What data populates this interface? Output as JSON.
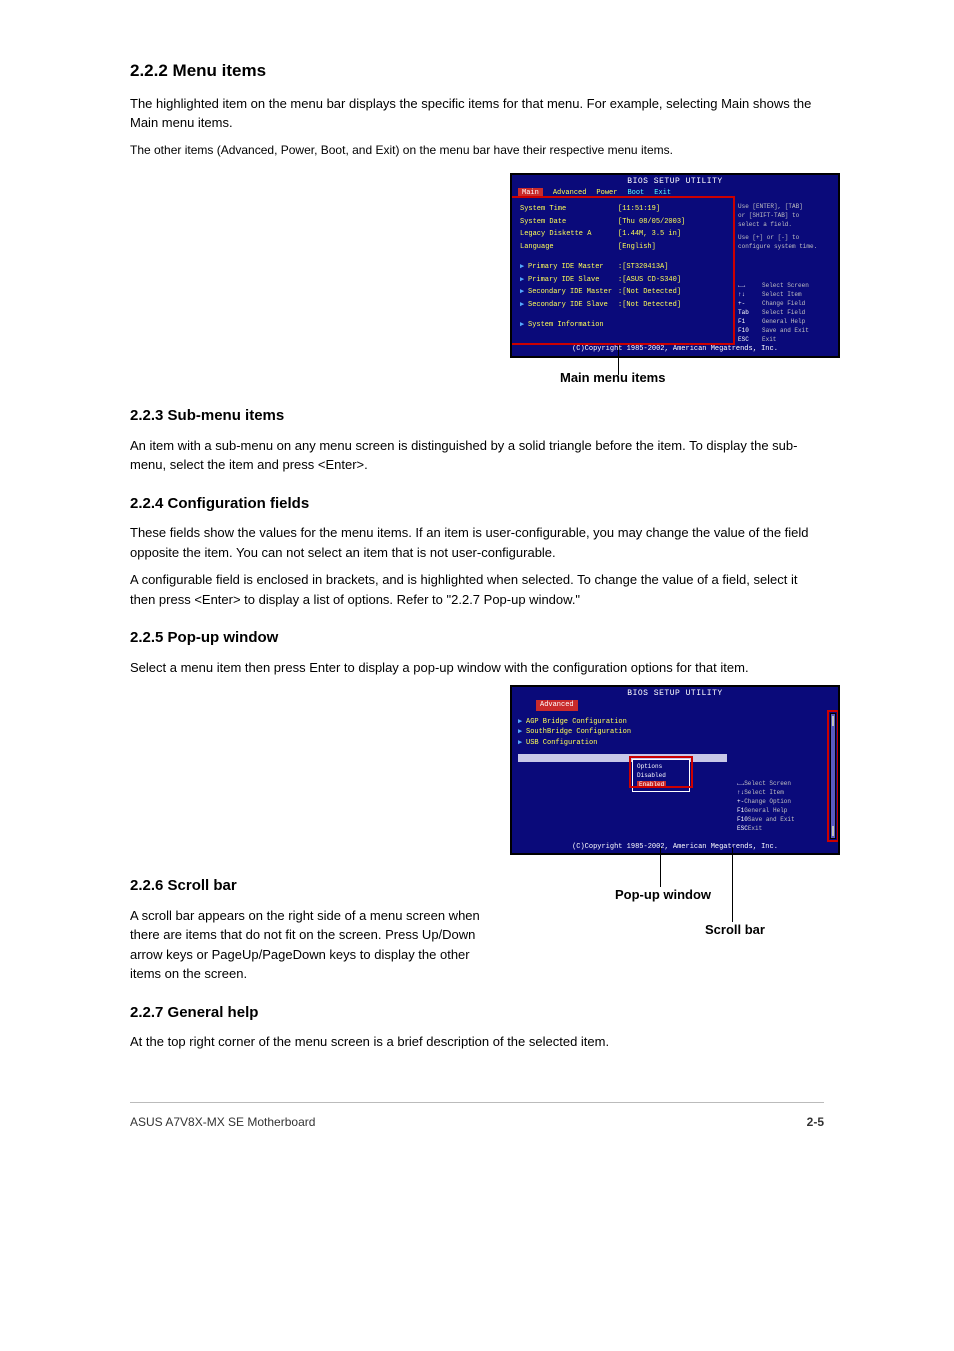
{
  "section_menu_items": {
    "title": "2.2.2 Menu items",
    "para1": "The highlighted item on the menu bar displays the specific items for that menu. For example, selecting Main shows the Main menu items.",
    "para2": "The other items (Advanced, Power, Boot, and Exit) on the menu bar have their respective menu items."
  },
  "bios1": {
    "title": "BIOS SETUP UTILITY",
    "menu": [
      "Main",
      "Advanced",
      "Power",
      "Boot",
      "Exit"
    ],
    "menu_selected": "Main",
    "rows": [
      {
        "label": "System Time",
        "value": "[11:51:19]"
      },
      {
        "label": "System Date",
        "value": "[Thu 08/05/2003]"
      },
      {
        "label": "Legacy Diskette A",
        "value": "[1.44M, 3.5 in]"
      },
      {
        "label": "Language",
        "value": "[English]"
      },
      {
        "label_blank": true
      },
      {
        "arrow": true,
        "label": "Primary IDE Master",
        "value": ":[ST320413A]"
      },
      {
        "arrow": true,
        "label": "Primary IDE Slave",
        "value": ":[ASUS CD-S340]"
      },
      {
        "arrow": true,
        "label": "Secondary IDE Master",
        "value": ":[Not Detected]"
      },
      {
        "arrow": true,
        "label": "Secondary IDE Slave",
        "value": ":[Not Detected]"
      },
      {
        "label_blank": true
      },
      {
        "arrow": true,
        "label": "System Information",
        "value": ""
      }
    ],
    "help_text": [
      "Use [ENTER], [TAB]",
      "or [SHIFT-TAB] to",
      "select a field.",
      "",
      "Use [+] or [-] to",
      "configure system time."
    ],
    "keys": [
      {
        "k": "←→",
        "d": "Select Screen"
      },
      {
        "k": "↑↓",
        "d": "Select Item"
      },
      {
        "k": "+-",
        "d": "Change Field"
      },
      {
        "k": "Tab",
        "d": "Select Field"
      },
      {
        "k": "F1",
        "d": "General Help"
      },
      {
        "k": "F10",
        "d": "Save and Exit"
      },
      {
        "k": "ESC",
        "d": "Exit"
      }
    ],
    "footer": "(C)Copyright 1985-2002, American Megatrends, Inc.",
    "callout": "Main menu items"
  },
  "section_submenu": {
    "title": "2.2.3 Sub-menu items",
    "text": "An item with a sub-menu on any menu screen is distinguished by a solid triangle before the item. To display the sub-menu, select the item and press <Enter>."
  },
  "section_config": {
    "title": "2.2.4 Configuration fields",
    "para1": "These fields show the values for the menu items. If an item is user-configurable, you may change the value of the field opposite the item. You can not select an item that is not user-configurable.",
    "para2": "A configurable field is enclosed in brackets, and is highlighted when selected. To change the value of a field, select it then press <Enter> to display a list of options. Refer to \"2.2.7 Pop-up window.\""
  },
  "section_popup": {
    "title": "2.2.5 Pop-up window",
    "text": "Select a menu item then press Enter to display a pop-up window with the configuration options for that item."
  },
  "bios2": {
    "title": "BIOS SETUP UTILITY",
    "tab": "Advanced",
    "items": [
      "AGP Bridge Configuration",
      "SouthBridge Configuration",
      "USB Configuration"
    ],
    "popup_title": "Options",
    "popup_options": [
      "Disabled",
      "Enabled"
    ],
    "popup_selected": "Enabled",
    "keys": [
      {
        "k": "←→",
        "d": "Select Screen"
      },
      {
        "k": "↑↓",
        "d": "Select Item"
      },
      {
        "k": "+-",
        "d": "Change Option"
      },
      {
        "k": "F1",
        "d": "General Help"
      },
      {
        "k": "F10",
        "d": "Save and Exit"
      },
      {
        "k": "ESC",
        "d": "Exit"
      }
    ],
    "footer": "(C)Copyright 1985-2002, American Megatrends, Inc.",
    "callout_popup": "Pop-up window",
    "callout_scroll": "Scroll bar"
  },
  "section_scroll": {
    "title": "2.2.6 Scroll bar",
    "text": "A scroll bar appears on the right side of a menu screen when there are items that do not fit on the screen. Press Up/Down arrow keys or PageUp/PageDown keys to display the other items on the screen."
  },
  "section_help": {
    "title": "2.2.7 General help",
    "text": "At the top right corner of the menu screen is a brief description of the selected item."
  },
  "footer": {
    "left": "ASUS A7V8X-MX SE Motherboard",
    "right": "2-5"
  }
}
